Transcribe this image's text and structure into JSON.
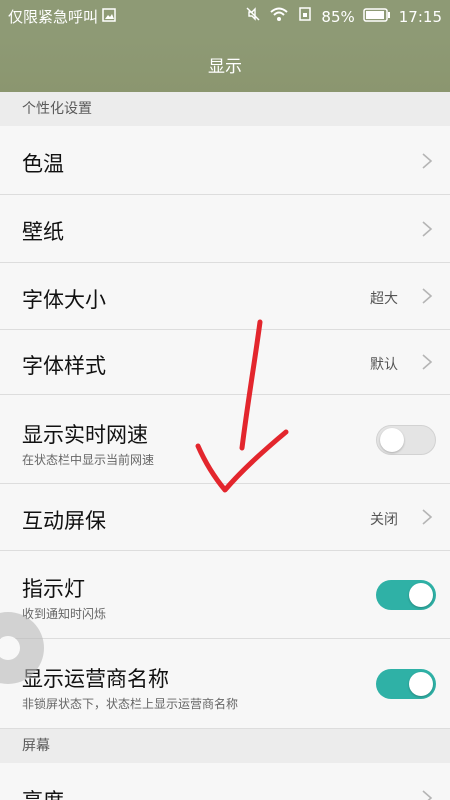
{
  "status_bar": {
    "carrier": "仅限紧急呼叫",
    "battery_percent": "85%",
    "time": "17:15",
    "icons": [
      "image-icon",
      "mute-icon",
      "wifi-icon",
      "sim-icon",
      "battery-icon"
    ]
  },
  "header": {
    "title": "显示"
  },
  "sections": {
    "personalize": "个性化设置",
    "screen": "屏幕"
  },
  "rows": {
    "color_temp": {
      "title": "色温"
    },
    "wallpaper": {
      "title": "壁纸"
    },
    "font_size": {
      "title": "字体大小",
      "value": "超大"
    },
    "font_style": {
      "title": "字体样式",
      "value": "默认"
    },
    "net_speed": {
      "title": "显示实时网速",
      "subtitle": "在状态栏中显示当前网速",
      "enabled": false
    },
    "screensaver": {
      "title": "互动屏保",
      "value": "关闭"
    },
    "indicator": {
      "title": "指示灯",
      "subtitle": "收到通知时闪烁",
      "enabled": true
    },
    "carrier_name": {
      "title": "显示运营商名称",
      "subtitle": "非锁屏状态下，状态栏上显示运营商名称",
      "enabled": true
    },
    "brightness": {
      "title": "亮度"
    }
  },
  "colors": {
    "header": "#8e9a75",
    "toggle_on": "#2fb1a6",
    "annotation": "#e3262d"
  }
}
